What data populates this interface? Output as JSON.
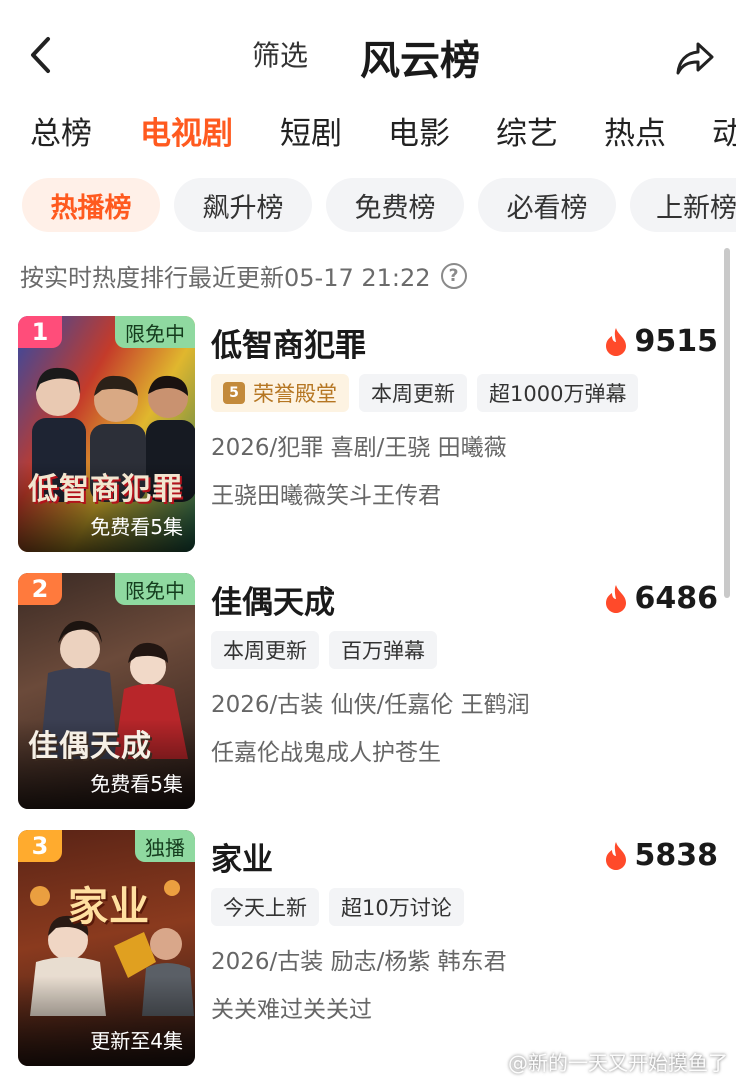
{
  "header": {
    "filter_label": "筛选",
    "title": "风云榜"
  },
  "category_tabs": [
    "总榜",
    "电视剧",
    "短剧",
    "电影",
    "综艺",
    "热点",
    "动"
  ],
  "active_category": "电视剧",
  "sub_tabs": [
    "热播榜",
    "飙升榜",
    "免费榜",
    "必看榜",
    "上新榜"
  ],
  "active_sub_tab": "热播榜",
  "update_note": "按实时热度排行最近更新05-17 21:22",
  "colors": {
    "accent": "#ff5a1f",
    "rank1": "#ff4d7a",
    "rank2": "#ff7a3d",
    "rank3": "#ffab2e",
    "status_badge": "#8fd9a0",
    "flame": "#ff4a2a"
  },
  "items": [
    {
      "rank": "1",
      "status": "限免中",
      "poster_title": "低智商犯罪",
      "poster_caption": "免费看5集",
      "title": "低智商犯罪",
      "heat": "9515",
      "honor_tag": "荣誉殿堂",
      "tags": [
        "本周更新",
        "超1000万弹幕"
      ],
      "meta": "2026/犯罪 喜剧/王骁 田曦薇",
      "desc": "王骁田曦薇笑斗王传君"
    },
    {
      "rank": "2",
      "status": "限免中",
      "poster_title": "佳偶天成",
      "poster_caption": "免费看5集",
      "title": "佳偶天成",
      "heat": "6486",
      "tags": [
        "本周更新",
        "百万弹幕"
      ],
      "meta": "2026/古装 仙侠/任嘉伦 王鹤润",
      "desc": "任嘉伦战鬼成人护苍生"
    },
    {
      "rank": "3",
      "status": "独播",
      "poster_title": "家业",
      "poster_caption": "更新至4集",
      "title": "家业",
      "heat": "5838",
      "tags": [
        "今天上新",
        "超10万讨论"
      ],
      "meta": "2026/古装 励志/杨紫 韩东君",
      "desc": "关关难过关关过"
    }
  ],
  "watermark": "@新的一天又开始摸鱼了"
}
